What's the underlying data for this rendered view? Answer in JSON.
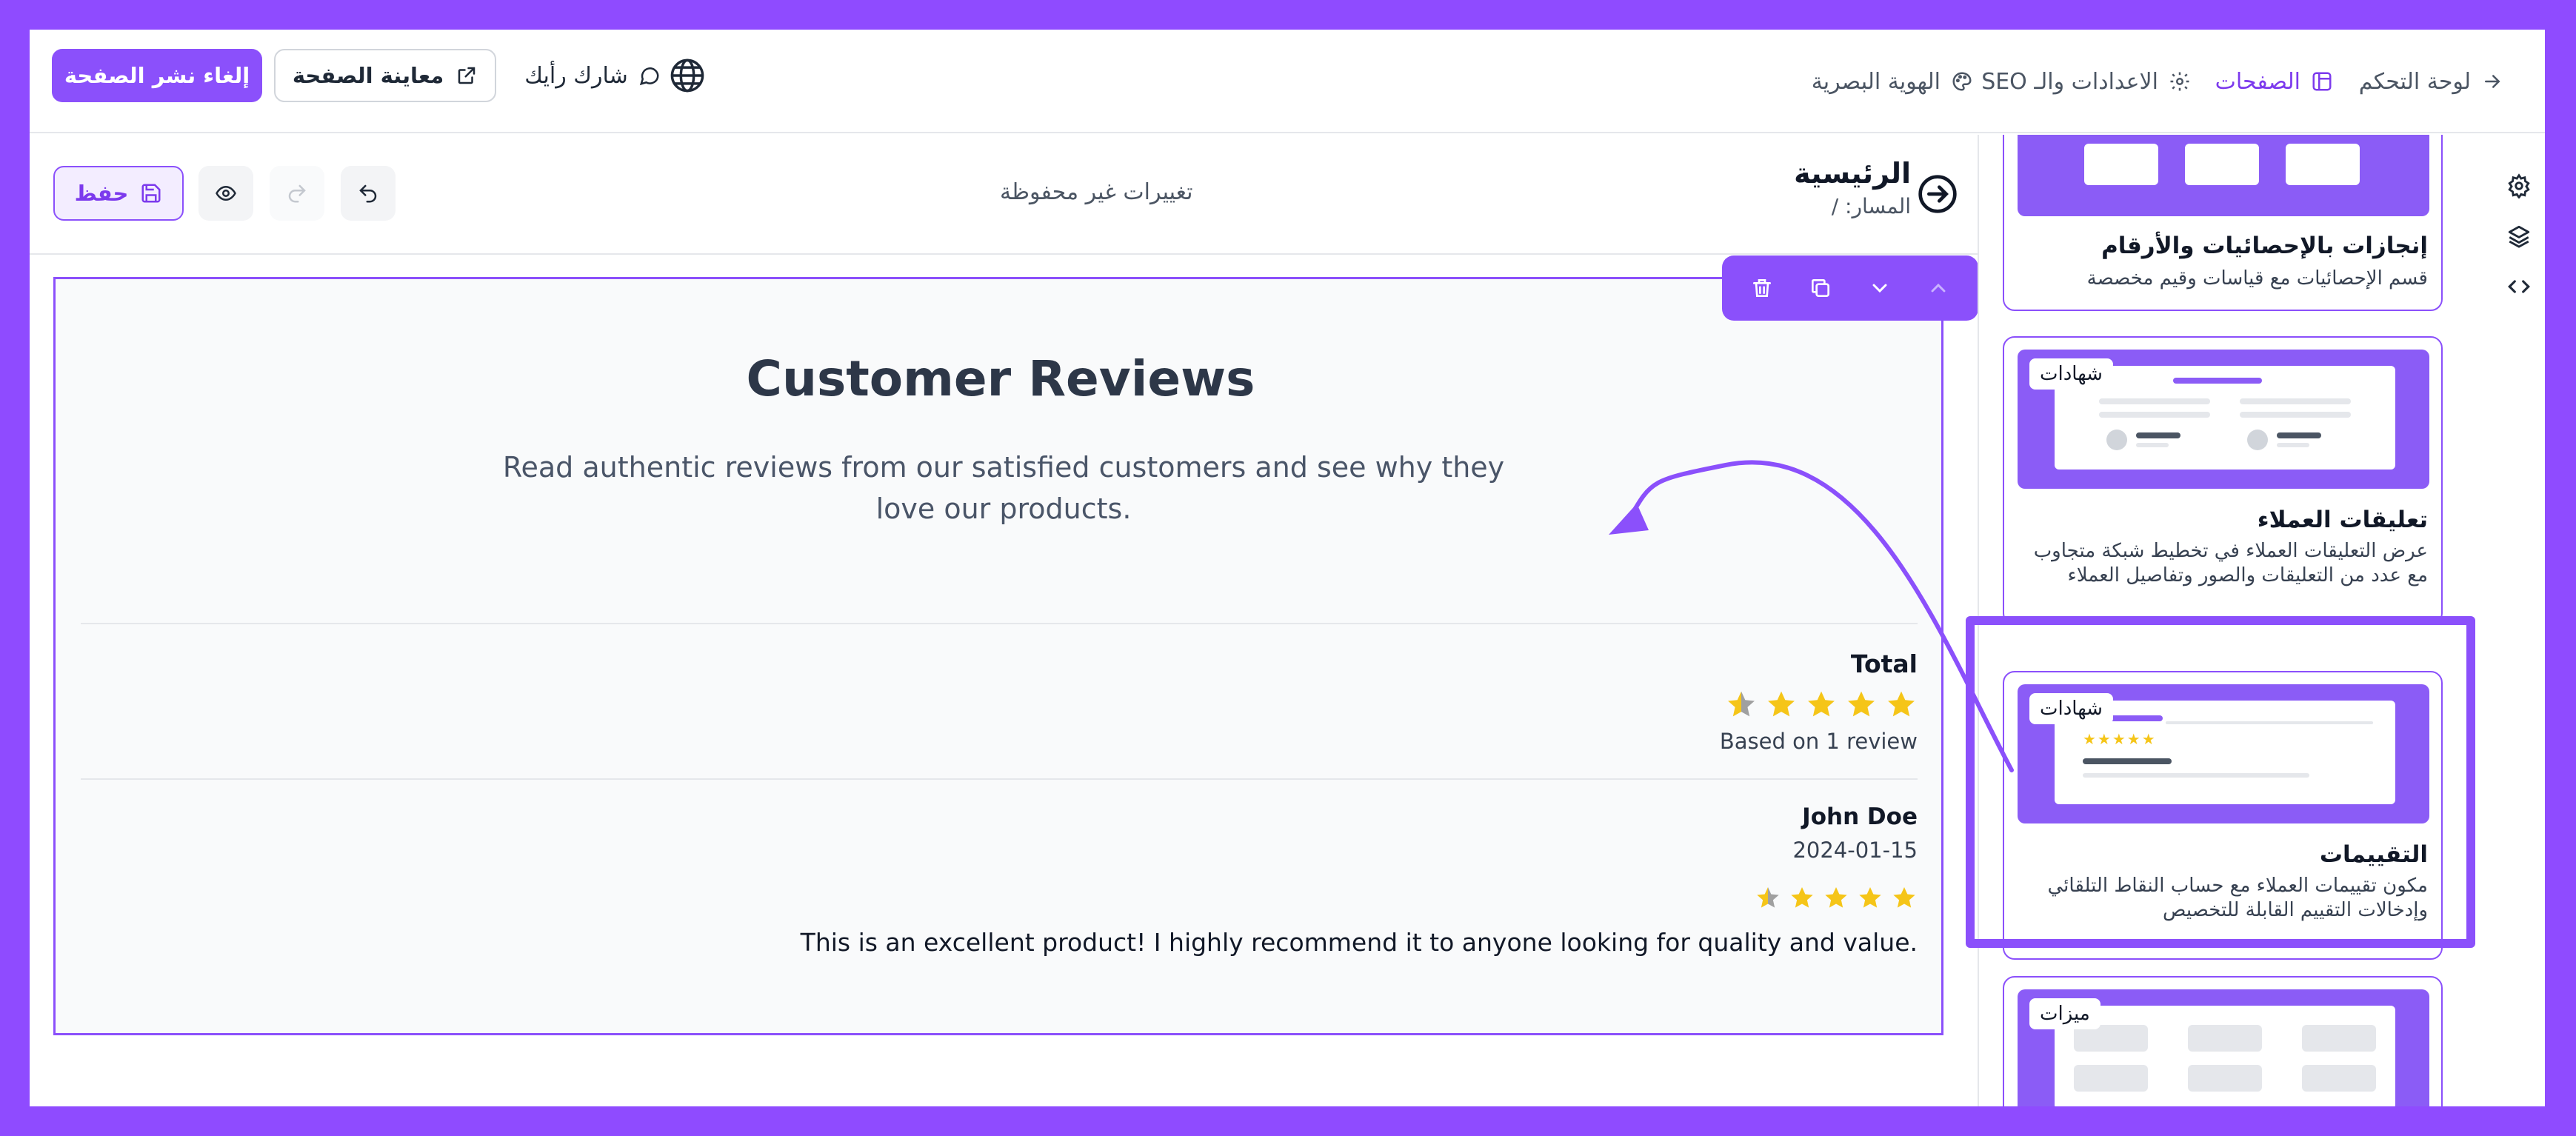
{
  "topbar": {
    "dashboard_label": "لوحة التحكم",
    "pages_label": "الصفحات",
    "seo_settings_label": "الاعدادات والـ SEO",
    "brand_identity_label": "الهوية البصرية",
    "share_label": "شارك رأيك",
    "preview_label": "معاينة الصفحة",
    "unpublish_label": "إلغاء نشر الصفحة"
  },
  "editor": {
    "page_title": "الرئيسية",
    "page_path": "المسار: /",
    "unsaved_status": "تغييرات غير محفوظة",
    "save_label": "حفظ"
  },
  "section": {
    "title": "Customer Reviews",
    "subtitle": "Read authentic reviews from our satisfied customers and see why they love our products.",
    "total_label": "Total",
    "total_rating": 4.5,
    "total_based_on": "Based on 1 review",
    "review": {
      "name": "John Doe",
      "date": "2024-01-15",
      "rating": 4.5,
      "text": "This is an excellent product! I highly recommend it to anyone looking for quality and value."
    }
  },
  "sidebar": {
    "cards": [
      {
        "title": "إنجازات بالإحصائيات والأرقام",
        "description": "قسم الإحصائيات مع قياسات وقيم مخصصة"
      },
      {
        "tag": "شهادات",
        "title": "تعليقات العملاء",
        "description": "عرض التعليقات العملاء في تخطيط شبكة متجاوب مع عدد من التعليقات والصور وتفاصيل العملاء"
      },
      {
        "tag": "شهادات",
        "title": "التقييمات",
        "description": "مكون تقييمات العملاء مع حساب النقاط التلقائي وإدخالات التقييم القابلة للتخصيص"
      },
      {
        "tag": "ميزات"
      }
    ]
  },
  "colors": {
    "accent": "#8b50fb",
    "star": "#f5c518",
    "star_empty": "#a0a0a0"
  }
}
